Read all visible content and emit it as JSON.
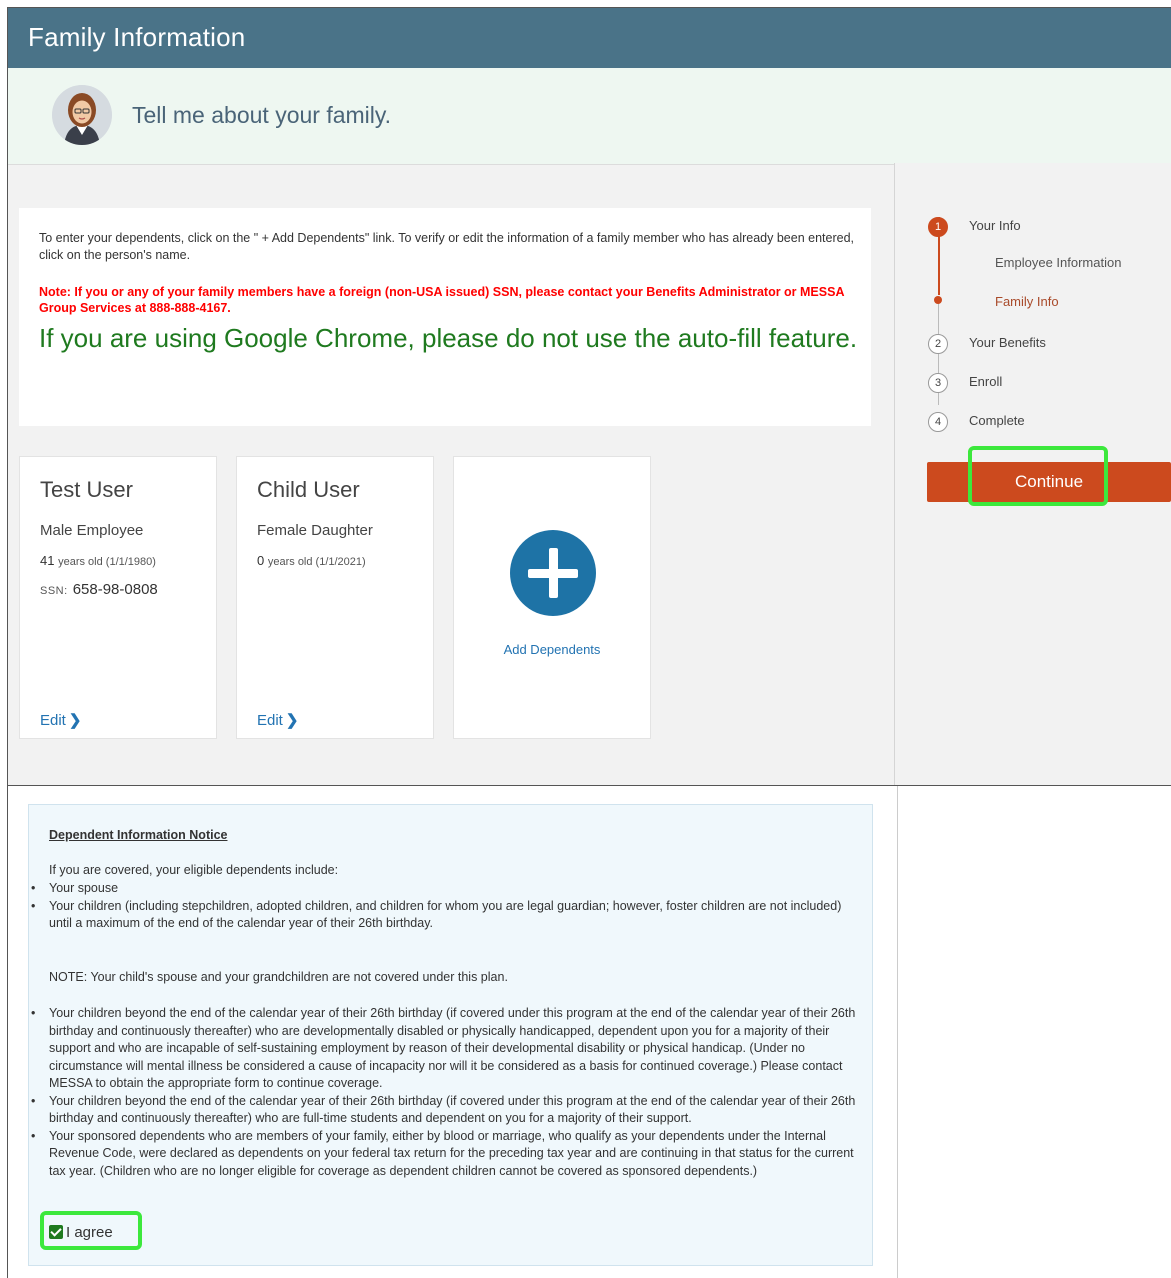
{
  "header": {
    "title": "Family Information"
  },
  "greeting": {
    "text": "Tell me about your family."
  },
  "notice": {
    "instructions": "To enter your dependents, click on the \" + Add Dependents\" link. To verify or edit the information of a family member who has already been entered, click on the person's name.",
    "ssn_note": "Note: If you or any of your family members have a foreign (non-USA issued) SSN, please contact your Benefits Administrator or MESSA Group Services at 888-888-4167.",
    "chrome_warning": "If you are using Google Chrome, please do not use the auto-fill feature."
  },
  "cards": [
    {
      "name": "Test User",
      "role": "Male Employee",
      "age_num": "41",
      "age_text": "years old (1/1/1980)",
      "ssn_label": "SSN:",
      "ssn": "658-98-0808",
      "edit": "Edit"
    },
    {
      "name": "Child User",
      "role": "Female Daughter",
      "age_num": "0",
      "age_text": "years old (1/1/2021)",
      "edit": "Edit"
    }
  ],
  "add_card": {
    "label": "Add Dependents"
  },
  "steps": [
    {
      "num": "1",
      "label": "Your Info",
      "state": "active"
    },
    {
      "num": "2",
      "label": "Your Benefits",
      "state": "idle"
    },
    {
      "num": "3",
      "label": "Enroll",
      "state": "idle"
    },
    {
      "num": "4",
      "label": "Complete",
      "state": "idle"
    }
  ],
  "substeps": [
    {
      "label": "Employee Information",
      "state": "done"
    },
    {
      "label": "Family Info",
      "state": "active"
    }
  ],
  "continue_label": "Continue",
  "dependent_notice": {
    "title": "Dependent Information Notice",
    "intro": "If you are covered, your eligible dependents include:",
    "list1": [
      "Your spouse",
      "Your children (including stepchildren, adopted children, and children for whom you are legal guardian; however, foster children are not included) until a maximum of the end of the calendar year of their 26th birthday."
    ],
    "note": "NOTE: Your child's spouse and your grandchildren are not covered under this plan.",
    "list2": [
      "Your children beyond the end of the calendar year of their 26th birthday (if covered under this program at the end of the calendar year of their 26th birthday and continuously thereafter) who are developmentally disabled or physically handicapped, dependent upon you for a majority of their support and who are incapable of self-sustaining employment by reason of their developmental disability or physical handicap. (Under no circumstance will mental illness be considered a cause of incapacity nor will it be considered as a basis for continued coverage.) Please contact MESSA to obtain the appropriate form to continue coverage.",
      "Your children beyond the end of the calendar year of their 26th birthday (if covered under this program at the end of the calendar year of their 26th birthday and continuously thereafter) who are full-time students and dependent on you for a majority of their support.",
      "Your sponsored dependents who are members of your family, either by blood or marriage, who qualify as your dependents under the Internal Revenue Code, were declared as dependents on your federal tax return for the preceding tax year and are continuing in that status for the current tax year. (Children who are no longer eligible for coverage as dependent children cannot be covered as sponsored dependents.)"
    ],
    "agree_label": "I agree",
    "agree_checked": true
  },
  "colors": {
    "header": "#4a7388",
    "accent": "#cc4a1e",
    "link": "#2273b2",
    "warning_red": "#ff0000",
    "warning_green": "#1f7a1f",
    "highlight": "#3ce83c"
  }
}
